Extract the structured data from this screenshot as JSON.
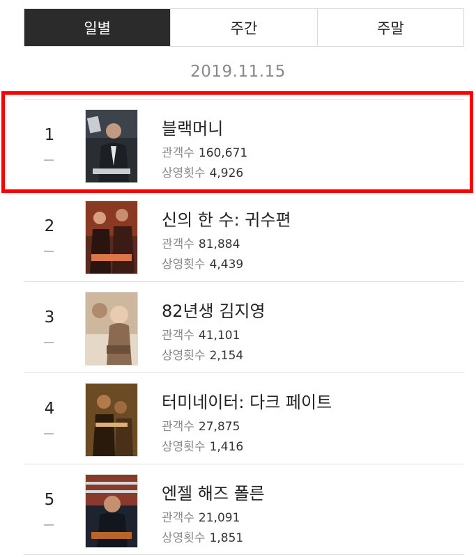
{
  "tabs": [
    {
      "label": "일별",
      "active": true
    },
    {
      "label": "주간",
      "active": false
    },
    {
      "label": "주말",
      "active": false
    }
  ],
  "date": "2019.11.15",
  "labels": {
    "audience": "관객수",
    "screenings": "상영횟수"
  },
  "movies": [
    {
      "rank": "1",
      "title": "블랙머니",
      "audience": "160,671",
      "screenings": "4,926",
      "change": "–",
      "poster_colors": [
        "#2a2e33",
        "#c9ccd1"
      ]
    },
    {
      "rank": "2",
      "title": "신의 한 수: 귀수편",
      "audience": "81,884",
      "screenings": "4,439",
      "change": "–",
      "poster_colors": [
        "#5a2a1e",
        "#d9774a"
      ]
    },
    {
      "rank": "3",
      "title": "82년생 김지영",
      "audience": "41,101",
      "screenings": "2,154",
      "change": "–",
      "poster_colors": [
        "#e6d8c6",
        "#8a6a50"
      ]
    },
    {
      "rank": "4",
      "title": "터미네이터: 다크 페이트",
      "audience": "27,875",
      "screenings": "1,416",
      "change": "–",
      "poster_colors": [
        "#3a2a18",
        "#c98a3a"
      ]
    },
    {
      "rank": "5",
      "title": "엔젤 해즈 폴른",
      "audience": "21,091",
      "screenings": "1,851",
      "change": "–",
      "poster_colors": [
        "#1d2430",
        "#b8652a"
      ]
    }
  ],
  "highlight_color": "#ff0000"
}
